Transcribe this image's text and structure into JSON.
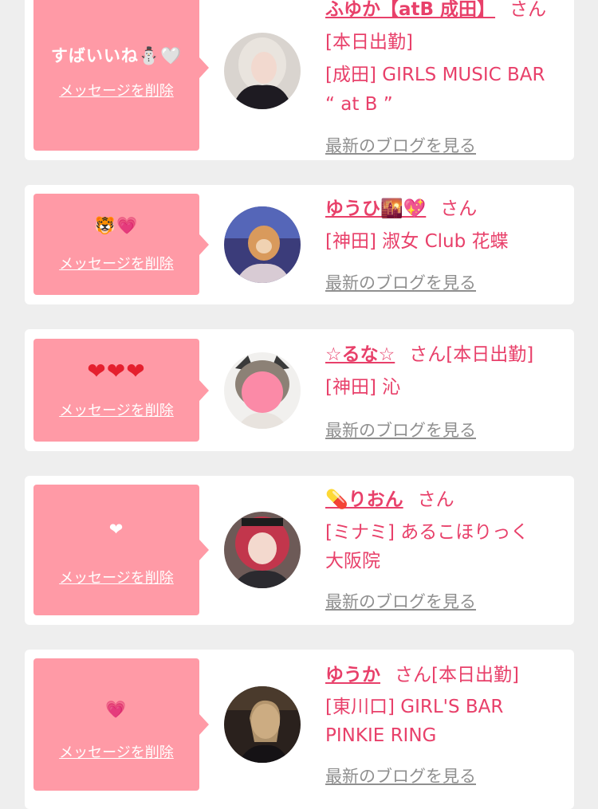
{
  "cards": [
    {
      "message": "すばいいね⛄🤍",
      "delete_label": "メッセージを削除",
      "name": "ふゆか【atB 成田】",
      "honorific": "さん",
      "attendance": "[本日出勤]",
      "shop_line1": "[成田] GIRLS MUSIC BAR",
      "shop_line2": "“ at B ”",
      "blog_label": "最新のブログを見る"
    },
    {
      "message": "🐯💗",
      "delete_label": "メッセージを削除",
      "name": "ゆうひ🌇💖",
      "honorific": "さん",
      "shop_line1": "[神田] 淑女 Club 花蝶",
      "blog_label": "最新のブログを見る"
    },
    {
      "message": "❤❤❤",
      "delete_label": "メッセージを削除",
      "name": "☆るな☆",
      "honorific": "さん",
      "attendance": "[本日出勤]",
      "shop_line1": "[神田] 沁",
      "blog_label": "最新のブログを見る"
    },
    {
      "message": "❤",
      "delete_label": "メッセージを削除",
      "name": "💊りおん",
      "honorific": "さん",
      "shop_line1": "[ミナミ] あるこほりっく",
      "shop_line2": "大阪院",
      "blog_label": "最新のブログを見る"
    },
    {
      "message": "💗",
      "delete_label": "メッセージを削除",
      "name": "ゆうか",
      "honorific": "さん",
      "attendance": "[本日出勤]",
      "shop_line1": "[東川口] GIRL'S BAR",
      "shop_line2": "PINKIE RING",
      "blog_label": "最新のブログを見る"
    }
  ],
  "colors": {
    "bubble": "#ff9aa6",
    "accent_text": "#e8406a",
    "blog_link": "#8f8f8f",
    "page_bg": "#eeeeee"
  }
}
